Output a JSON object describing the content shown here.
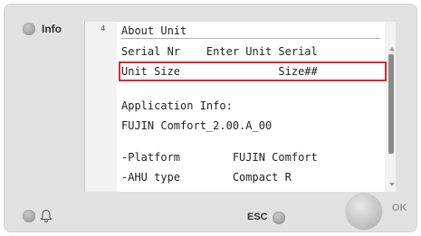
{
  "panel": {
    "info_label": "Info",
    "esc_label": "ESC",
    "ok_label": "OK"
  },
  "screen": {
    "line_number": "4",
    "header": "About Unit",
    "rows": [
      "Serial Nr    Enter Unit Serial",
      "Unit Size               Size##",
      "",
      "Application Info:",
      "FUJIN Comfort_2.00.A_00",
      "",
      "-Platform        FUJIN Comfort",
      "-AHU type        Compact R"
    ],
    "selected_row_index": 0
  },
  "icons": {
    "header_arrow": "play-icon",
    "alarm": "bell-icon",
    "scroll_up": "scroll-up-icon",
    "scroll_down": "scroll-down-icon"
  },
  "colors": {
    "selection": "#e0262f",
    "arrow": "#3a9a2a"
  }
}
